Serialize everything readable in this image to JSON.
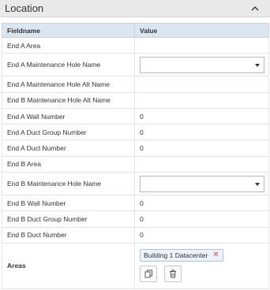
{
  "panel": {
    "title": "Location"
  },
  "grid": {
    "headers": {
      "field": "Fieldname",
      "value": "Value"
    },
    "rows": [
      {
        "field": "End A Area",
        "value": ""
      },
      {
        "field": "End A Maintenance Hole Name",
        "value": ""
      },
      {
        "field": "End A Maintenance Hole Alt Name",
        "value": ""
      },
      {
        "field": "End B Maintenance Hole Alt Name",
        "value": ""
      },
      {
        "field": "End A Wall Number",
        "value": "0"
      },
      {
        "field": "End A Duct Group Number",
        "value": "0"
      },
      {
        "field": "End A Duct Number",
        "value": "0"
      },
      {
        "field": "End B Area",
        "value": ""
      },
      {
        "field": "End B Maintenance Hole Name",
        "value": ""
      },
      {
        "field": "End B Wall Number",
        "value": "0"
      },
      {
        "field": "End B Duct Group Number",
        "value": "0"
      },
      {
        "field": "End B Duct Number",
        "value": "0"
      },
      {
        "field": "Areas",
        "value": ""
      }
    ],
    "areas": {
      "chips": [
        {
          "label": "Building 1 Datacenter",
          "remove": "✕"
        }
      ]
    }
  },
  "icons": {
    "collapse": "chevron-up-icon",
    "dropdown": "caret-down-icon",
    "copy": "copy-icon",
    "delete": "trash-icon"
  },
  "colors": {
    "header_bg": "#e9e9e9",
    "grid_header_bg": "#dbe5f0",
    "chip_bg": "#edf2f8",
    "remove_red": "#d9534f"
  }
}
